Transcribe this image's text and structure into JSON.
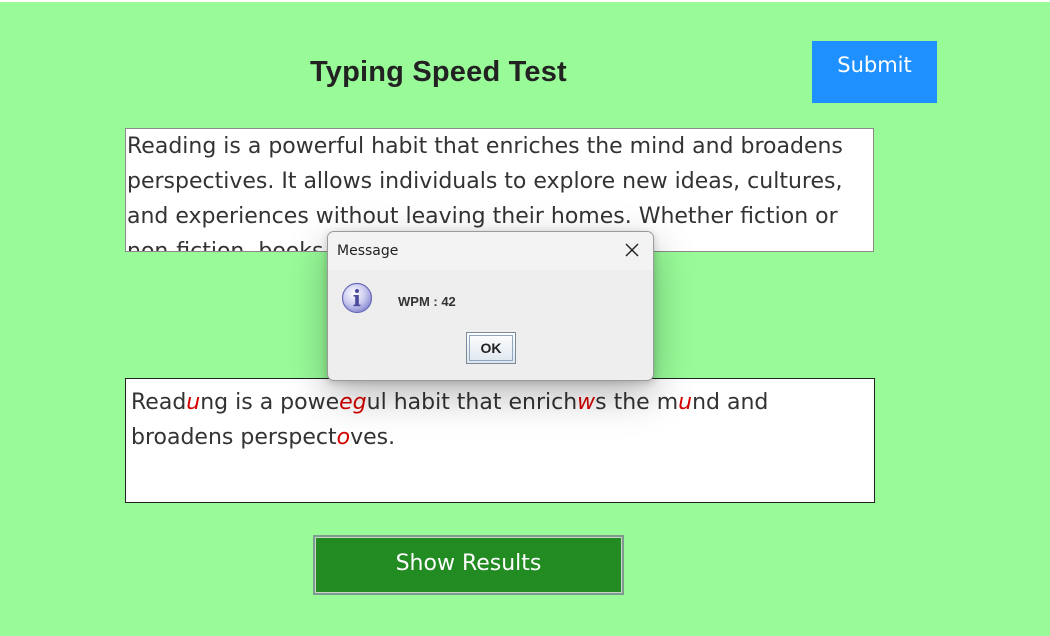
{
  "app": {
    "title": "Typing Speed Test",
    "submit_label": "Submit",
    "show_results_label": "Show Results",
    "background_color": "#98fb98"
  },
  "passage": {
    "text": "Reading is a powerful habit that enriches the mind and broadens perspectives. It allows individuals to explore new ideas, cultures, and experiences without leaving their homes. Whether fiction or non-fiction, books can improve vocabulary, and"
  },
  "typed": {
    "segments": [
      {
        "text": "Read",
        "error": false
      },
      {
        "text": "u",
        "error": true
      },
      {
        "text": "ng is a powe",
        "error": false
      },
      {
        "text": "eg",
        "error": true
      },
      {
        "text": "ul habit that enrich",
        "error": false
      },
      {
        "text": "w",
        "error": true
      },
      {
        "text": "s the m",
        "error": false
      },
      {
        "text": "u",
        "error": true
      },
      {
        "text": "nd and broadens perspect",
        "error": false
      },
      {
        "text": "o",
        "error": true
      },
      {
        "text": "ves.",
        "error": false
      }
    ],
    "error_color": "#d40000"
  },
  "dialog": {
    "title": "Message",
    "message": "WPM : 42",
    "ok_label": "OK",
    "icon": "info-icon"
  },
  "colors": {
    "submit_bg": "#1e90ff",
    "show_results_bg": "#228b22"
  }
}
